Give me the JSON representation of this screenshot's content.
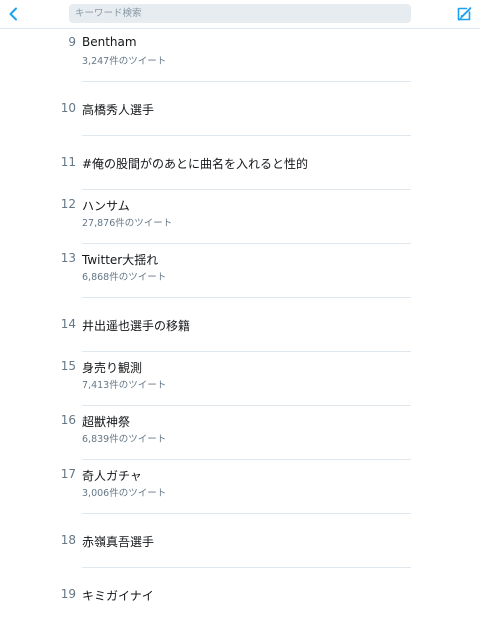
{
  "header": {
    "search_placeholder": "キーワード検索",
    "back_icon": "chevron-left-icon",
    "compose_icon": "compose-icon",
    "accent_color": "#1da1f2"
  },
  "trends": [
    {
      "rank": "9",
      "name": "Bentham",
      "count": "3,247件のツイート"
    },
    {
      "rank": "10",
      "name": "高橋秀人選手",
      "count": ""
    },
    {
      "rank": "11",
      "name": "#俺の股間がのあとに曲名を入れると性的",
      "count": ""
    },
    {
      "rank": "12",
      "name": "ハンサム",
      "count": "27,876件のツイート"
    },
    {
      "rank": "13",
      "name": "Twitter大揺れ",
      "count": "6,868件のツイート"
    },
    {
      "rank": "14",
      "name": "井出遥也選手の移籍",
      "count": ""
    },
    {
      "rank": "15",
      "name": "身売り観測",
      "count": "7,413件のツイート"
    },
    {
      "rank": "16",
      "name": "超獣神祭",
      "count": "6,839件のツイート"
    },
    {
      "rank": "17",
      "name": "奇人ガチャ",
      "count": "3,006件のツイート"
    },
    {
      "rank": "18",
      "name": "赤嶺真吾選手",
      "count": ""
    },
    {
      "rank": "19",
      "name": "キミガイナイ",
      "count": ""
    }
  ]
}
